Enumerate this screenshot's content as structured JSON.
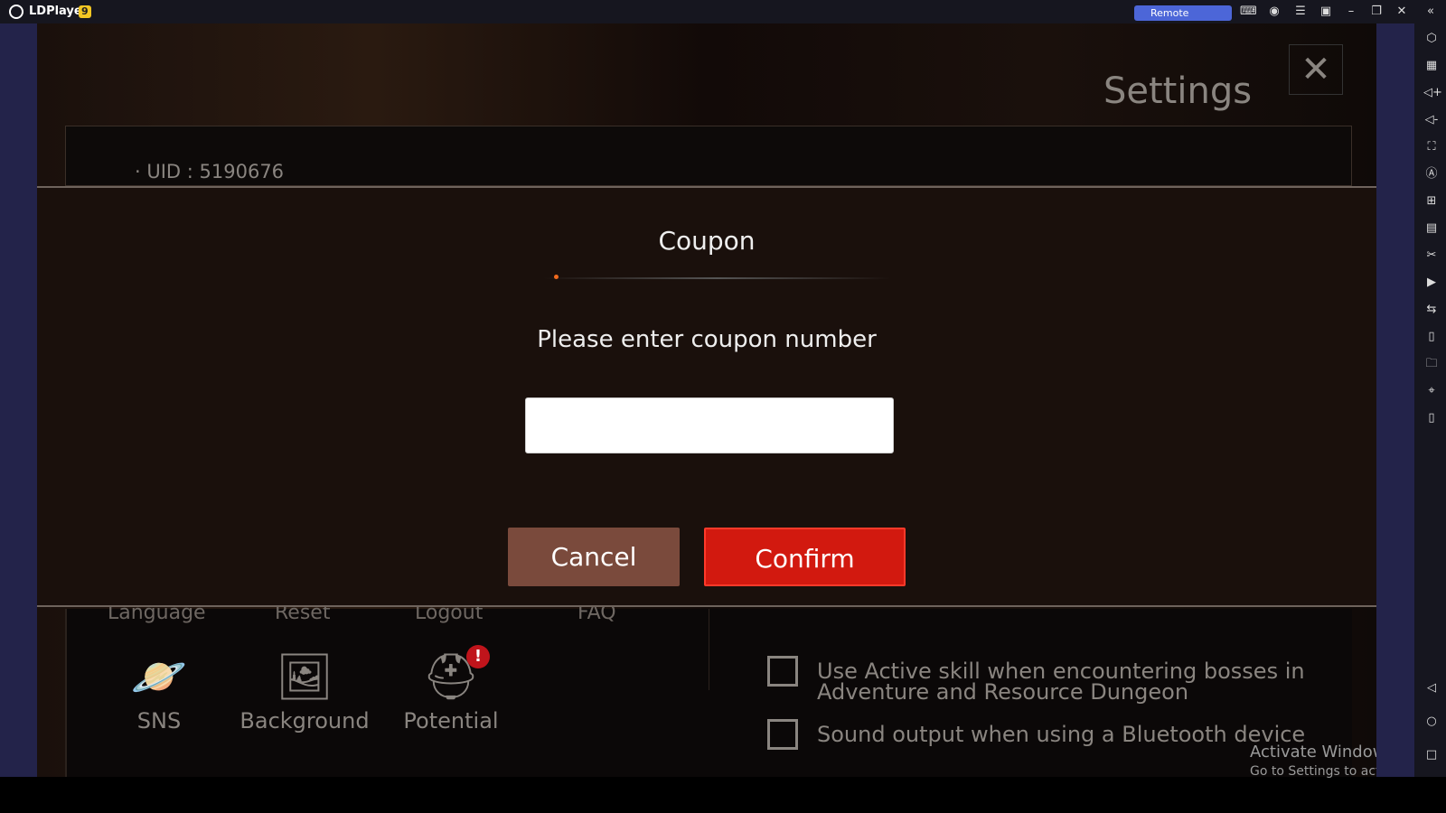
{
  "titlebar": {
    "app_name": "LDPlayer",
    "version": "9",
    "remote_label": "Remote LDPlayer",
    "icons": [
      "gamepad-icon",
      "account-icon",
      "menu-icon",
      "screen-icon",
      "minimize-icon",
      "restore-icon",
      "close-icon",
      "collapse-icon"
    ]
  },
  "sidebar": {
    "icons": [
      "settings-icon",
      "keyboard-icon",
      "volume-up-icon",
      "volume-down-icon",
      "fullscreen-icon",
      "auto-rotate-icon",
      "add-window-icon",
      "apk-icon",
      "scissors-icon",
      "record-icon",
      "sync-icon",
      "shake-icon",
      "folder-icon",
      "location-icon",
      "rotate-icon",
      "back-icon",
      "home-icon",
      "recents-icon"
    ]
  },
  "game": {
    "settings_title": "Settings",
    "close_glyph": "✕",
    "uid": "· UID : 5190676",
    "dialog": {
      "title": "Coupon",
      "prompt": "Please enter coupon number",
      "input_value": "",
      "cancel": "Cancel",
      "confirm": "Confirm"
    },
    "menu_cut": [
      "Language",
      "Reset",
      "Logout",
      "FAQ"
    ],
    "features": [
      {
        "label": "SNS",
        "icon": "planet-icon"
      },
      {
        "label": "Background",
        "icon": "image-icon"
      },
      {
        "label": "Potential",
        "icon": "spartan-helmet-icon",
        "badge": "!"
      }
    ],
    "options": [
      {
        "label": "Use Active skill when encountering bosses in Adventure and Resource Dungeon",
        "checked": false
      },
      {
        "label": "Sound output when using a Bluetooth device",
        "checked": false
      }
    ]
  },
  "watermark": {
    "line1": "Activate Windows",
    "line2": "Go to Settings to activate Windows."
  }
}
